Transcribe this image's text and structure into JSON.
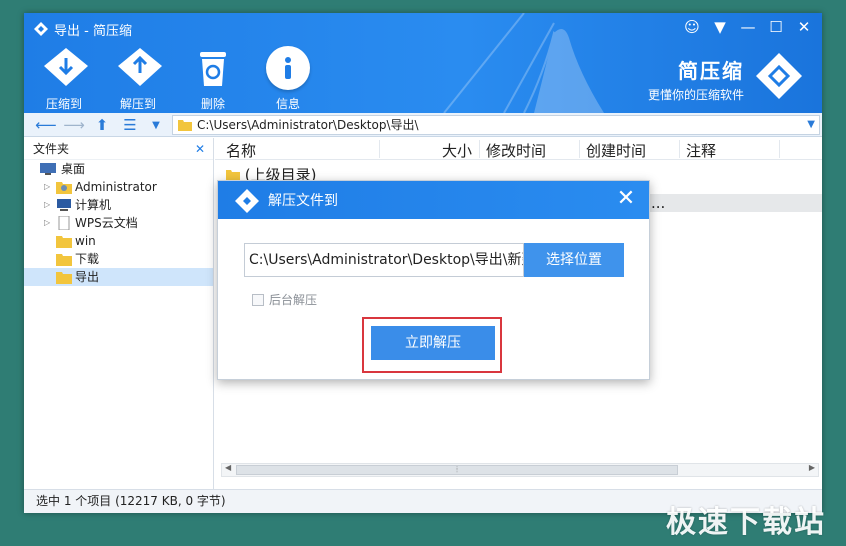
{
  "window": {
    "title": "导出 - 简压缩"
  },
  "toolbar": {
    "compress_label": "压缩到",
    "extract_label": "解压到",
    "delete_label": "删除",
    "info_label": "信息"
  },
  "brand": {
    "name": "简压缩",
    "slogan": "更懂你的压缩软件"
  },
  "address": {
    "path": "C:\\Users\\Administrator\\Desktop\\导出\\"
  },
  "sidebar": {
    "header": "文件夹",
    "items": [
      {
        "label": "桌面"
      },
      {
        "label": "Administrator"
      },
      {
        "label": "计算机"
      },
      {
        "label": "WPS云文档"
      },
      {
        "label": "win"
      },
      {
        "label": "下载"
      },
      {
        "label": "导出"
      }
    ]
  },
  "list": {
    "columns": [
      "名称",
      "大小",
      "修改时间",
      "创建时间",
      "注释"
    ],
    "rows": [
      {
        "name": "(上级目录)"
      },
      {
        "name_fragment": "..."
      }
    ]
  },
  "status": {
    "text": "选中 1 个项目 (12217 KB, 0 字节)"
  },
  "dialog": {
    "title": "解压文件到",
    "dest_value": "C:\\Users\\Administrator\\Desktop\\导出\\新建",
    "choose_label": "选择位置",
    "background_label": "后台解压",
    "extract_label": "立即解压"
  },
  "watermark": "极速下载站",
  "colors": {
    "accent": "#1f7de6",
    "button": "#3a8de9",
    "highlight": "#d9363e",
    "selection": "#cfe5fb"
  }
}
